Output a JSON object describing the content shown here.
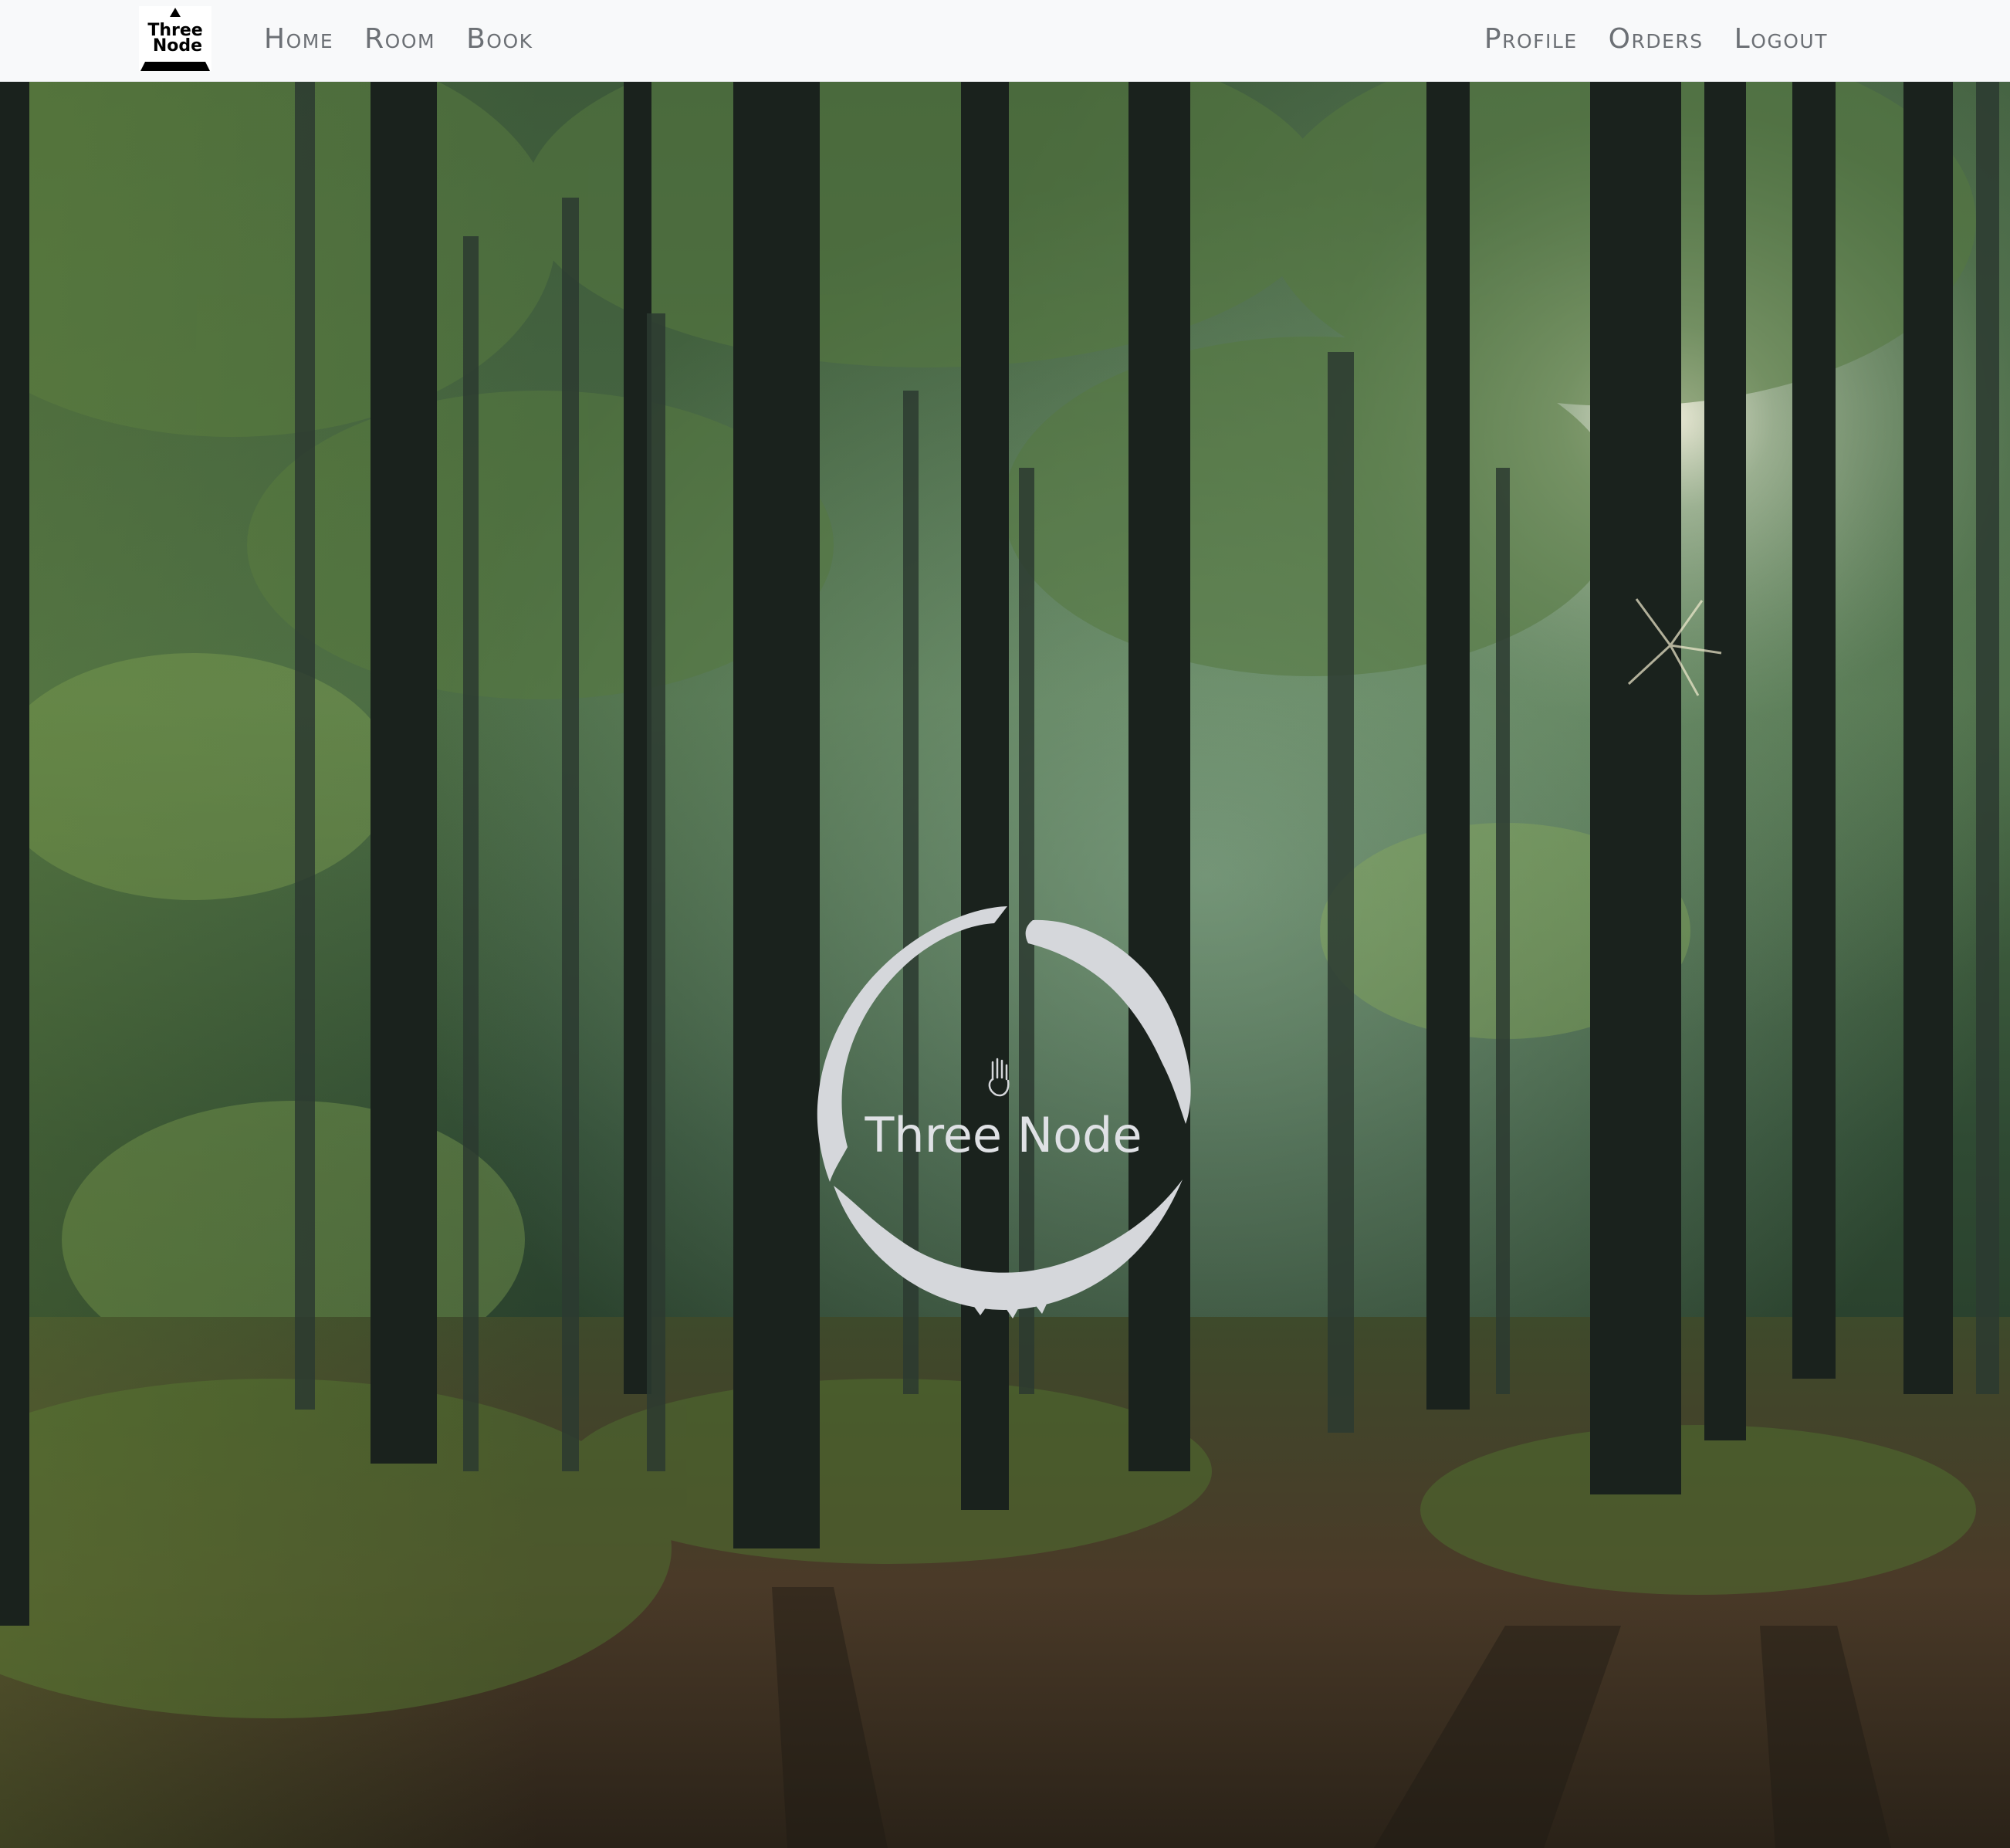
{
  "navbar": {
    "brand": {
      "line1": "Three",
      "line2": "Node",
      "icon": "triangle-logo-icon"
    },
    "left_links": [
      {
        "label": "Home"
      },
      {
        "label": "Room"
      },
      {
        "label": "Book"
      }
    ],
    "right_links": [
      {
        "label": "Profile"
      },
      {
        "label": "Orders"
      },
      {
        "label": "Logout"
      }
    ]
  },
  "hero": {
    "background": "forest-photo",
    "logo": {
      "text": "Three Node",
      "icon": "brush-circle-icon",
      "emblem": "hand-icon"
    }
  },
  "colors": {
    "navbar_bg": "#f8f9fa",
    "nav_link": "#6c7075",
    "logo_fill": "#dfe1e5"
  }
}
